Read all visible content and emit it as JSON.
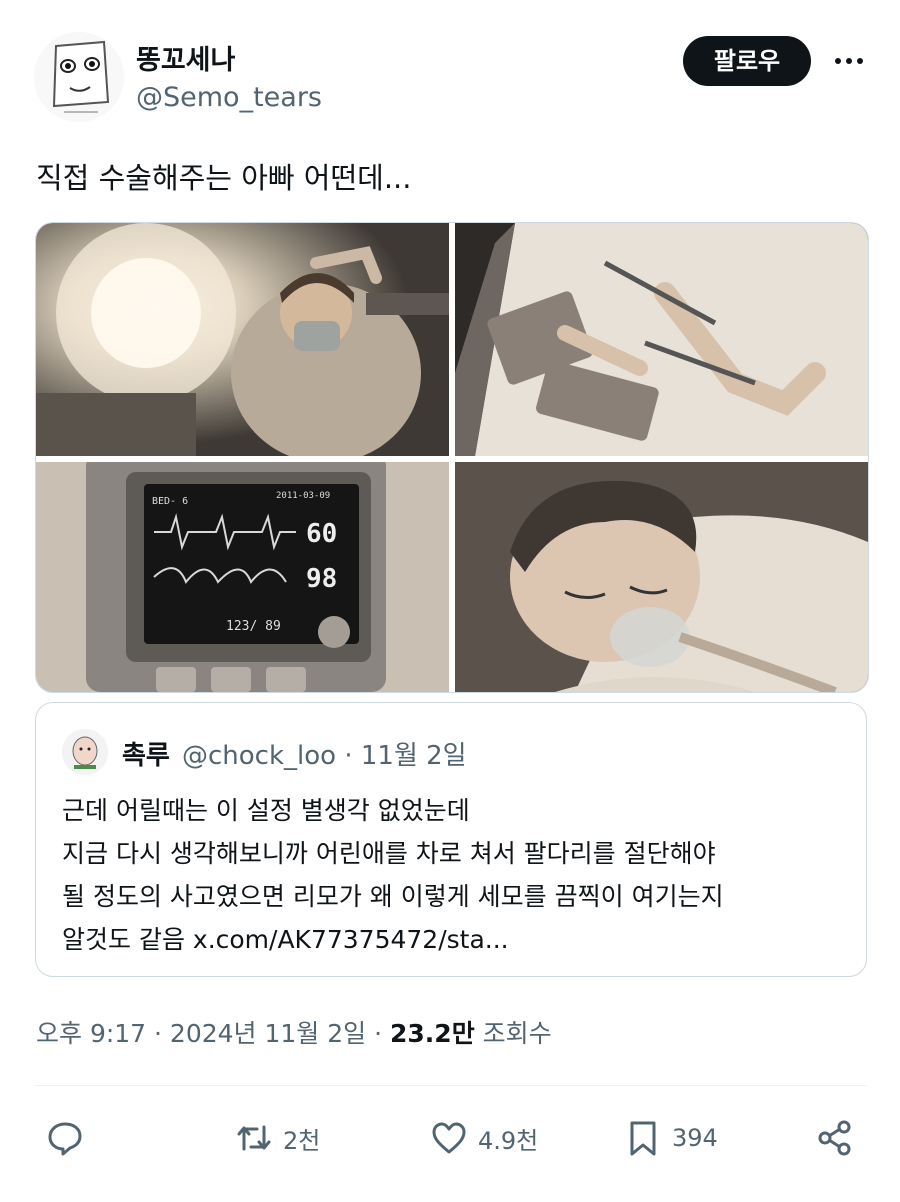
{
  "author": {
    "name": "똥꼬세나",
    "handle": "@Semo_tears"
  },
  "follow_label": "팔로우",
  "tweet_text": "직접 수술해주는 아빠 어떤데...",
  "quote": {
    "name": "촉루",
    "handle_date": "@chock_loo · 11월 2일",
    "lines": [
      "근데 어릴때는 이 설정 별생각 없었눈데",
      "지금 다시 생각해보니까 어린애를 차로 쳐서 팔다리를 절단해야",
      "될 정도의 사고였으면 리모가 왜 이렇게 세모를 끔찍이 여기는지",
      "알것도 같음 x.com/AK77375472/sta..."
    ]
  },
  "timestamp": {
    "prefix": "오후 9:17 · 2024년 11월 2일 · ",
    "views": "23.2만",
    "views_suffix": " 조회수"
  },
  "monitor": {
    "hr": "60",
    "spo2": "98",
    "bp": "123/ 89",
    "bed": "BED- 6",
    "date": "2011-03-09"
  },
  "actions": {
    "reply": "",
    "retweet": "2천",
    "like": "4.9천",
    "bookmark": "394"
  },
  "colors": {
    "text": "#0f1419",
    "secondary": "#536471",
    "border": "#cfd9de",
    "button": "#0f1419"
  },
  "icons": [
    "more-icon",
    "reply-icon",
    "retweet-icon",
    "like-icon",
    "bookmark-icon",
    "share-icon"
  ]
}
